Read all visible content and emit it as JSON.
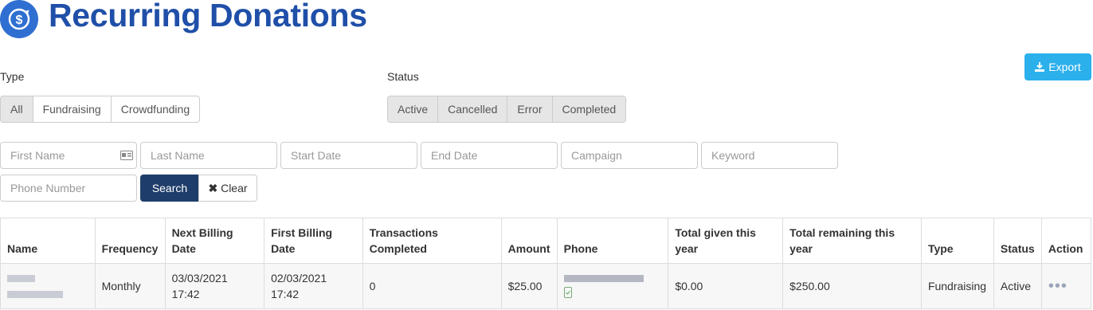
{
  "page": {
    "title": "Recurring Donations"
  },
  "filters": {
    "type_label": "Type",
    "type_options": [
      "All",
      "Fundraising",
      "Crowdfunding"
    ],
    "status_label": "Status",
    "status_options": [
      "Active",
      "Cancelled",
      "Error",
      "Completed"
    ]
  },
  "search": {
    "first_name": "First Name",
    "last_name": "Last Name",
    "start_date": "Start Date",
    "end_date": "End Date",
    "campaign": "Campaign",
    "keyword": "Keyword",
    "phone": "Phone Number",
    "search_label": "Search",
    "clear_label": "Clear"
  },
  "toolbar": {
    "export_label": "Export"
  },
  "table": {
    "headers": [
      "Name",
      "Frequency",
      "Next Billing Date",
      "First Billing Date",
      "Transactions Completed",
      "Amount",
      "Phone",
      "Total given this year",
      "Total remaining this year",
      "Type",
      "Status",
      "Action"
    ],
    "rows": [
      {
        "frequency": "Monthly",
        "next_billing_date": "03/03/2021",
        "next_billing_time": "17:42",
        "first_billing_date": "02/03/2021",
        "first_billing_time": "17:42",
        "transactions": "0",
        "amount": "$25.00",
        "total_given": "$0.00",
        "total_remaining": "$250.00",
        "type": "Fundraising",
        "status": "Active",
        "action": "•••"
      }
    ]
  },
  "colors": {
    "brand": "#1f4fa8",
    "export": "#2bb0ec",
    "search": "#1f3d6b"
  }
}
